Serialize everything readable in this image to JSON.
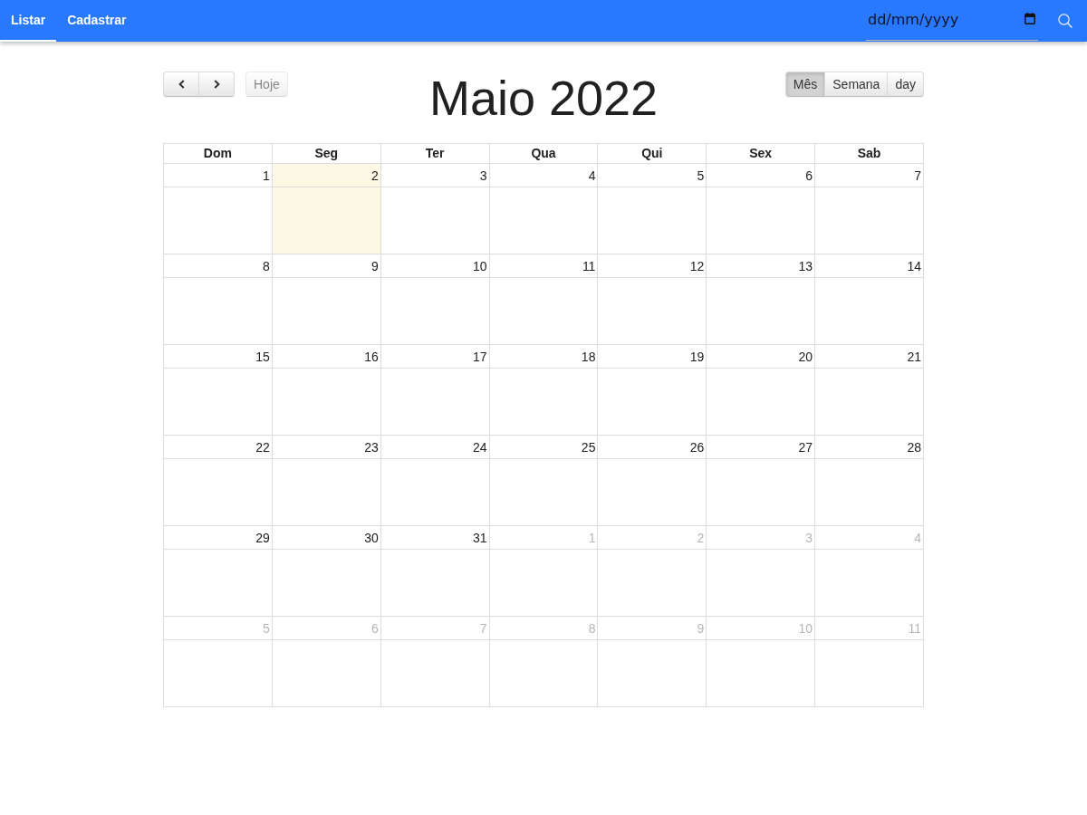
{
  "nav": {
    "tabs": [
      {
        "label": "Listar",
        "selected": true
      },
      {
        "label": "Cadastrar",
        "selected": false
      }
    ],
    "date_field": {
      "placeholder": "dd/mm/yyyy"
    }
  },
  "toolbar": {
    "today_button": {
      "label": "Hoje",
      "disabled": true
    },
    "title": "Maio 2022",
    "views": [
      {
        "label": "Mês",
        "selected": true
      },
      {
        "label": "Semana",
        "selected": false
      },
      {
        "label": "day",
        "selected": false
      }
    ]
  },
  "calendar": {
    "weekdays": [
      "Dom",
      "Seg",
      "Ter",
      "Qua",
      "Qui",
      "Sex",
      "Sab"
    ],
    "weeks": [
      {
        "days": [
          {
            "day": "1",
            "other_month": false,
            "today": false
          },
          {
            "day": "2",
            "other_month": false,
            "today": true
          },
          {
            "day": "3",
            "other_month": false,
            "today": false
          },
          {
            "day": "4",
            "other_month": false,
            "today": false
          },
          {
            "day": "5",
            "other_month": false,
            "today": false
          },
          {
            "day": "6",
            "other_month": false,
            "today": false
          },
          {
            "day": "7",
            "other_month": false,
            "today": false
          }
        ]
      },
      {
        "days": [
          {
            "day": "8",
            "other_month": false,
            "today": false
          },
          {
            "day": "9",
            "other_month": false,
            "today": false
          },
          {
            "day": "10",
            "other_month": false,
            "today": false
          },
          {
            "day": "11",
            "other_month": false,
            "today": false
          },
          {
            "day": "12",
            "other_month": false,
            "today": false
          },
          {
            "day": "13",
            "other_month": false,
            "today": false
          },
          {
            "day": "14",
            "other_month": false,
            "today": false
          }
        ]
      },
      {
        "days": [
          {
            "day": "15",
            "other_month": false,
            "today": false
          },
          {
            "day": "16",
            "other_month": false,
            "today": false
          },
          {
            "day": "17",
            "other_month": false,
            "today": false
          },
          {
            "day": "18",
            "other_month": false,
            "today": false
          },
          {
            "day": "19",
            "other_month": false,
            "today": false
          },
          {
            "day": "20",
            "other_month": false,
            "today": false
          },
          {
            "day": "21",
            "other_month": false,
            "today": false
          }
        ]
      },
      {
        "days": [
          {
            "day": "22",
            "other_month": false,
            "today": false
          },
          {
            "day": "23",
            "other_month": false,
            "today": false
          },
          {
            "day": "24",
            "other_month": false,
            "today": false
          },
          {
            "day": "25",
            "other_month": false,
            "today": false
          },
          {
            "day": "26",
            "other_month": false,
            "today": false
          },
          {
            "day": "27",
            "other_month": false,
            "today": false
          },
          {
            "day": "28",
            "other_month": false,
            "today": false
          }
        ]
      },
      {
        "days": [
          {
            "day": "29",
            "other_month": false,
            "today": false
          },
          {
            "day": "30",
            "other_month": false,
            "today": false
          },
          {
            "day": "31",
            "other_month": false,
            "today": false
          },
          {
            "day": "1",
            "other_month": true,
            "today": false
          },
          {
            "day": "2",
            "other_month": true,
            "today": false
          },
          {
            "day": "3",
            "other_month": true,
            "today": false
          },
          {
            "day": "4",
            "other_month": true,
            "today": false
          }
        ]
      },
      {
        "days": [
          {
            "day": "5",
            "other_month": true,
            "today": false
          },
          {
            "day": "6",
            "other_month": true,
            "today": false
          },
          {
            "day": "7",
            "other_month": true,
            "today": false
          },
          {
            "day": "8",
            "other_month": true,
            "today": false
          },
          {
            "day": "9",
            "other_month": true,
            "today": false
          },
          {
            "day": "10",
            "other_month": true,
            "today": false
          },
          {
            "day": "11",
            "other_month": true,
            "today": false
          }
        ]
      }
    ]
  }
}
